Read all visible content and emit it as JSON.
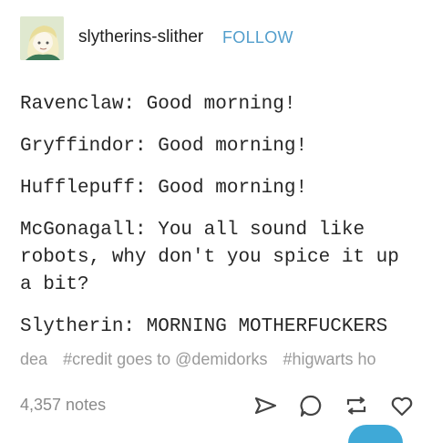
{
  "blog": {
    "name": "slytherins-slither",
    "follow_label": "FOLLOW"
  },
  "post": {
    "lines": [
      "Ravenclaw: Good morning!",
      "Gryffindor: Good morning!",
      "Hufflepuff: Good morning!",
      "McGonagall: You all sound like\nrobots, why don't you spice it up\na bit?",
      "Slytherin: MORNING MOTHERFUCKERS"
    ]
  },
  "tags": [
    "dea",
    "#credit goes to @demidorks",
    "#higwarts ho"
  ],
  "footer": {
    "notes": "4,357 notes",
    "icons": [
      "share-icon",
      "reply-icon",
      "reblog-icon",
      "like-icon"
    ]
  },
  "colors": {
    "accent": "#529ecc",
    "text": "#262626",
    "muted": "#9a9a9a"
  }
}
